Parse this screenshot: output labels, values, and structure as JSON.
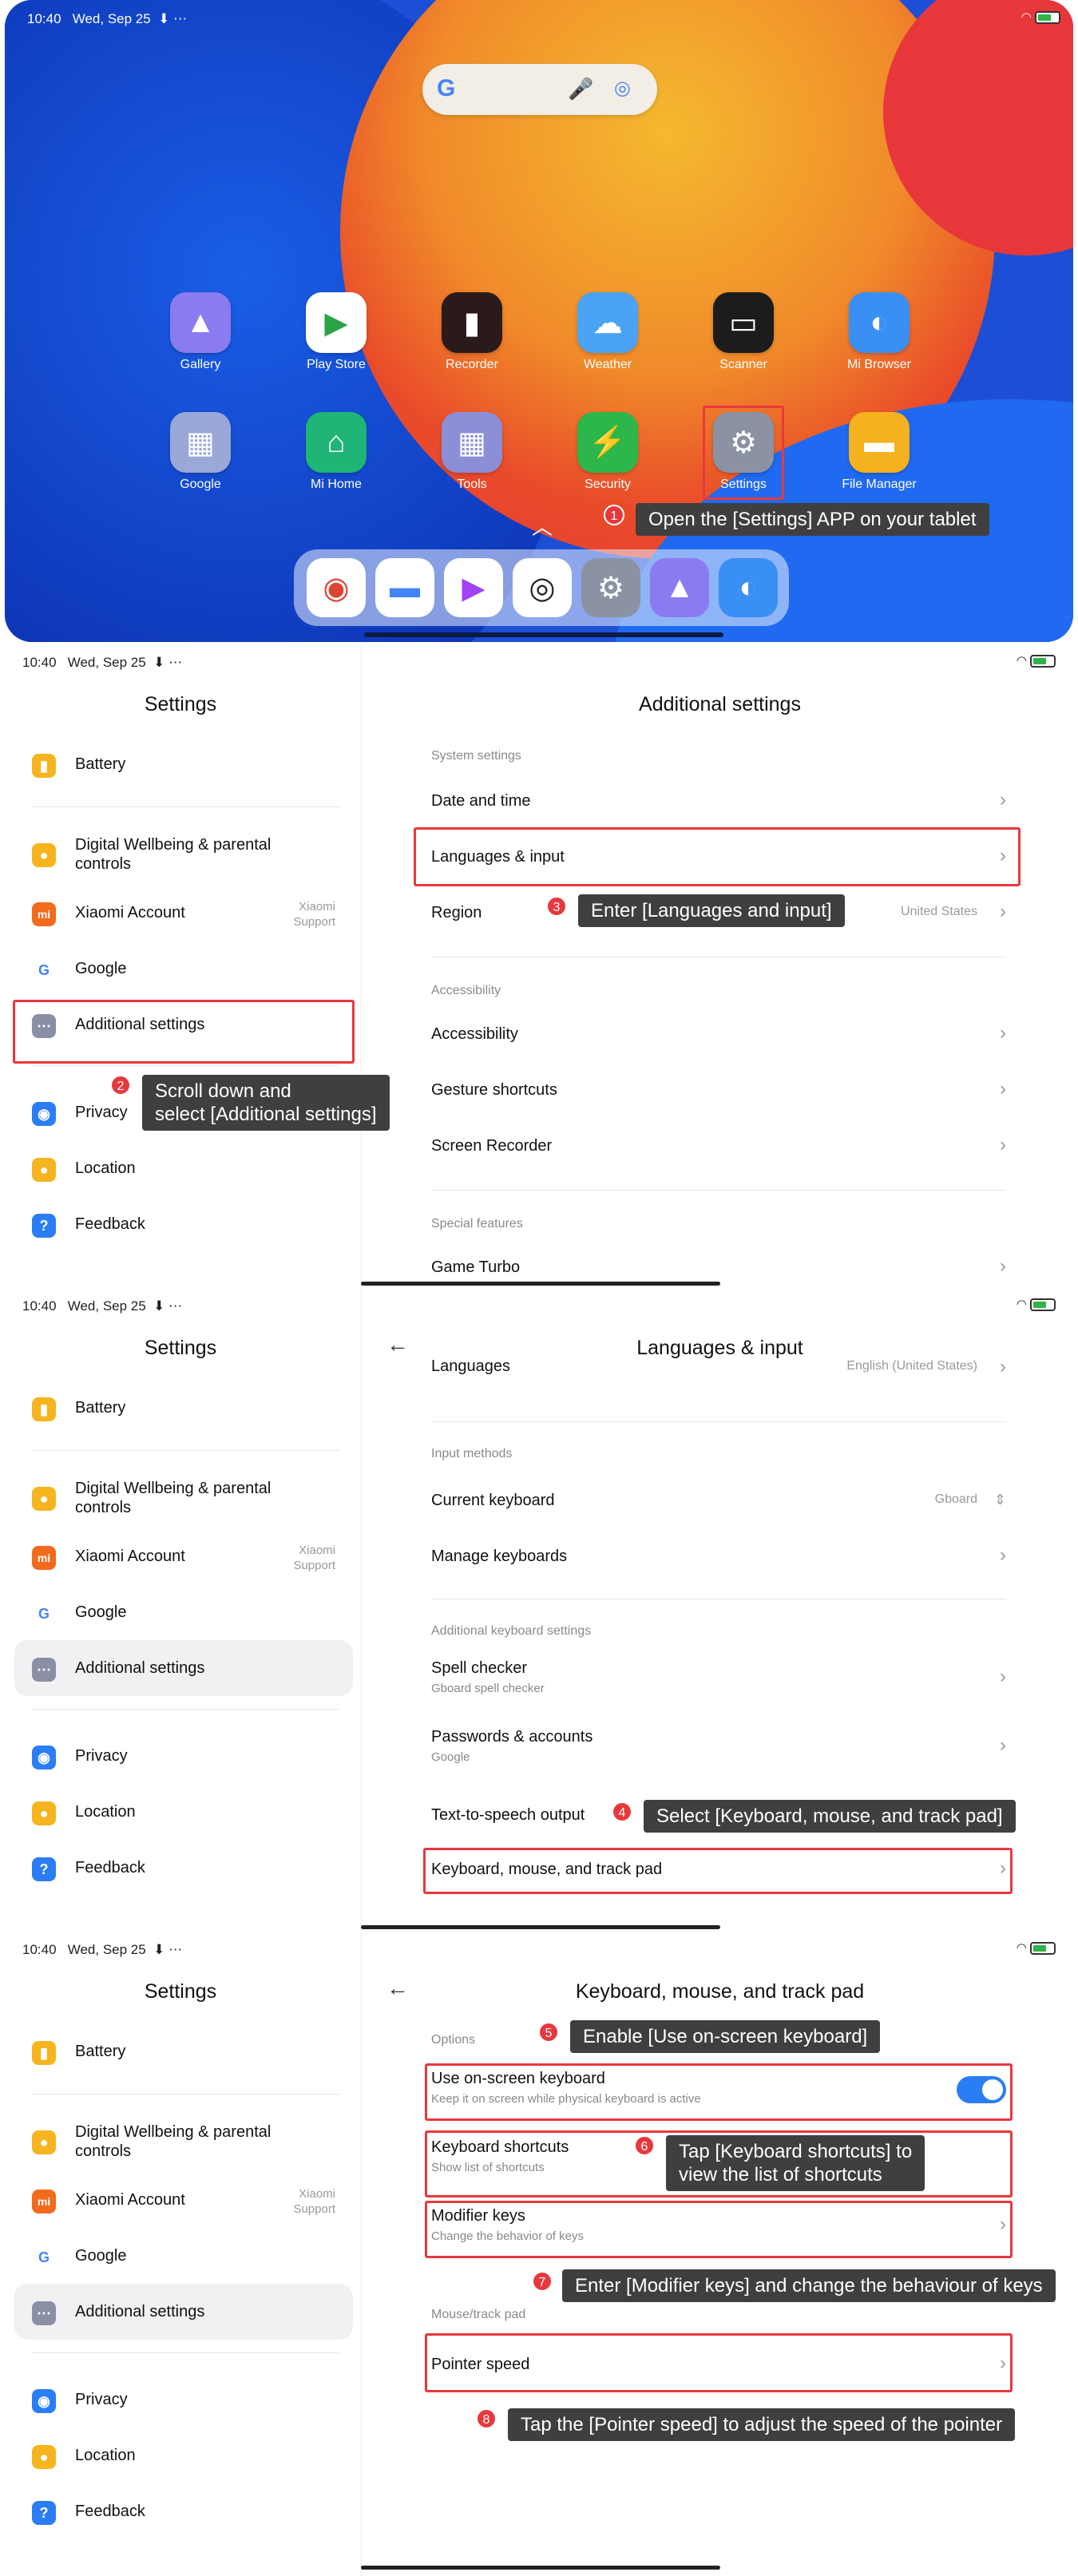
{
  "status_bar": {
    "time": "10:40",
    "date": "Wed, Sep 25",
    "icons": "⬇ ⋯",
    "battery": "85"
  },
  "home": {
    "search_g": "G",
    "apps_row1": [
      {
        "label": "Gallery",
        "icon": "gallery-icon",
        "color": "#8a7cf0"
      },
      {
        "label": "Play Store",
        "icon": "play-store-icon",
        "color": "#ffffff"
      },
      {
        "label": "Recorder",
        "icon": "recorder-icon",
        "color": "#2a1a1a"
      },
      {
        "label": "Weather",
        "icon": "weather-icon",
        "color": "#4aa3f4"
      },
      {
        "label": "Scanner",
        "icon": "scanner-icon",
        "color": "#1c1c1c"
      },
      {
        "label": "Mi Browser",
        "icon": "browser-icon",
        "color": "#3a8ff5"
      }
    ],
    "apps_row2": [
      {
        "label": "Google",
        "icon": "google-folder-icon",
        "color": "#9aa8d8"
      },
      {
        "label": "Mi Home",
        "icon": "mi-home-icon",
        "color": "#1fb576"
      },
      {
        "label": "Tools",
        "icon": "tools-folder-icon",
        "color": "#8c8fd8"
      },
      {
        "label": "Security",
        "icon": "security-icon",
        "color": "#2db64a"
      },
      {
        "label": "Settings",
        "icon": "settings-icon",
        "color": "#8a92a4"
      },
      {
        "label": "File Manager",
        "icon": "file-manager-icon",
        "color": "#f5b21e"
      }
    ],
    "dock_icons": [
      "chrome-icon",
      "messages-icon",
      "play-games-icon",
      "camera-icon",
      "settings-icon",
      "gallery-icon",
      "browser-icon"
    ]
  },
  "sidebar": {
    "title": "Settings",
    "items": {
      "battery": "Battery",
      "wellbeing": "Digital Wellbeing & parental controls",
      "xiaomi": "Xiaomi Account",
      "xiaomi_sub": "Xiaomi\nSupport",
      "google": "Google",
      "additional": "Additional settings",
      "privacy": "Privacy",
      "location": "Location",
      "feedback": "Feedback"
    }
  },
  "panel2": {
    "title": "Additional settings",
    "sec_system": "System settings",
    "date_time": "Date and time",
    "languages_input": "Languages & input",
    "region": "Region",
    "region_value": "United States",
    "sec_accessibility": "Accessibility",
    "accessibility": "Accessibility",
    "gesture": "Gesture shortcuts",
    "screen_recorder": "Screen Recorder",
    "sec_special": "Special features",
    "game_turbo": "Game Turbo"
  },
  "panel3": {
    "title": "Languages & input",
    "languages": "Languages",
    "languages_value": "English (United States)",
    "sec_input": "Input methods",
    "current_keyboard": "Current keyboard",
    "current_keyboard_value": "Gboard",
    "manage_keyboards": "Manage keyboards",
    "sec_additional": "Additional keyboard settings",
    "spell_checker": "Spell checker",
    "spell_checker_sub": "Gboard spell checker",
    "passwords": "Passwords & accounts",
    "passwords_sub": "Google",
    "tts": "Text-to-speech output",
    "kmt": "Keyboard, mouse, and track pad"
  },
  "panel4": {
    "title": "Keyboard, mouse, and track pad",
    "sec_options": "Options",
    "onscreen": "Use on-screen keyboard",
    "onscreen_sub": "Keep it on screen while physical keyboard is active",
    "onscreen_state": "on",
    "shortcuts": "Keyboard shortcuts",
    "shortcuts_sub": "Show list of shortcuts",
    "modifier": "Modifier keys",
    "modifier_sub": "Change the behavior of keys",
    "sec_mouse": "Mouse/track pad",
    "pointer": "Pointer speed"
  },
  "annotations": {
    "n1": "1",
    "t1": "Open the [Settings] APP on your tablet",
    "n2": "2",
    "t2": "Scroll down and\nselect [Additional settings]",
    "n3": "3",
    "t3": "Enter [Languages and input]",
    "n4": "4",
    "t4": "Select [Keyboard, mouse, and track pad]",
    "n5": "5",
    "t5": "Enable [Use on-screen keyboard]",
    "n6": "6",
    "t6": "Tap [Keyboard shortcuts] to\nview the list of shortcuts",
    "n7": "7",
    "t7": "Enter [Modifier keys] and change the behaviour of keys",
    "n8": "8",
    "t8": "Tap the [Pointer speed] to adjust the speed of the pointer"
  },
  "colors": {
    "accent": "#2a7df4",
    "annotation": "#e8383d",
    "note_bg": "#3f3f3f"
  }
}
